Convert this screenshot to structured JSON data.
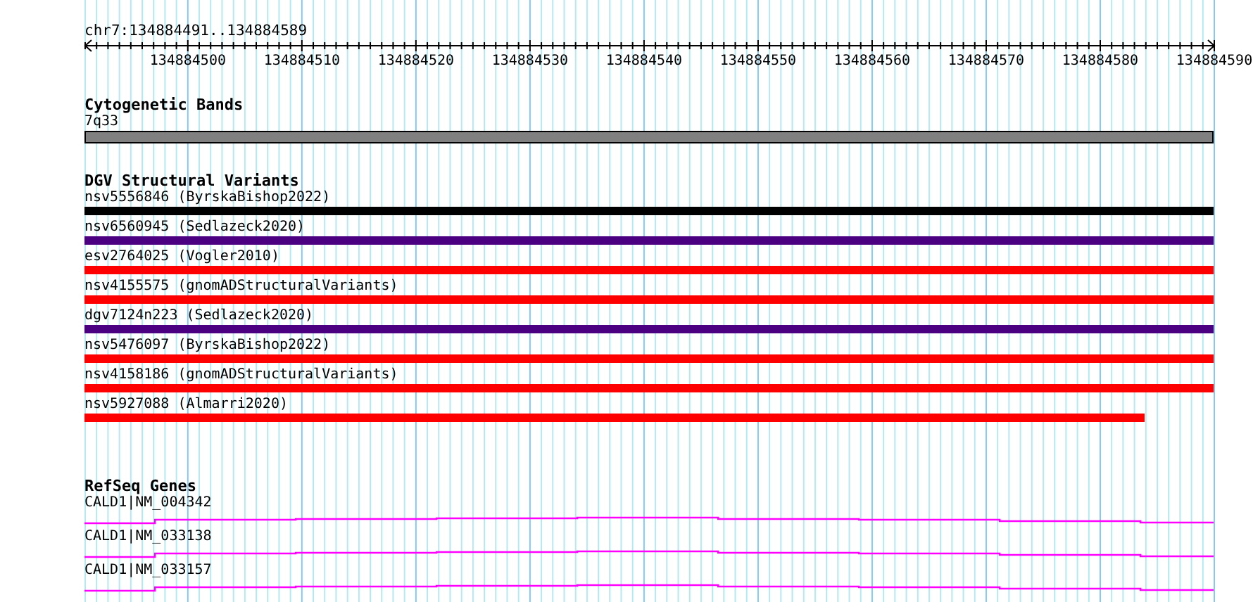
{
  "location": "chr7:134884491..134884589",
  "ruler": {
    "labels": [
      "134884500",
      "134884510",
      "134884520",
      "134884530",
      "134884540",
      "134884550",
      "134884560",
      "134884570",
      "134884580",
      "134884590"
    ]
  },
  "cytogenetic_bands": {
    "title": "Cytogenetic Bands",
    "band": {
      "label": "7q33"
    }
  },
  "dgv_structural_variants": {
    "title": "DGV Structural Variants",
    "variants": [
      {
        "label": "nsv5556846 (ByrskaBishop2022)",
        "color": "#000000",
        "extends_past_view": true
      },
      {
        "label": "nsv6560945 (Sedlazeck2020)",
        "color": "#4b0082",
        "extends_past_view": true
      },
      {
        "label": "esv2764025 (Vogler2010)",
        "color": "#ff0000",
        "extends_past_view": true
      },
      {
        "label": "nsv4155575 (gnomADStructuralVariants)",
        "color": "#ff0000",
        "extends_past_view": true
      },
      {
        "label": "dgv7124n223 (Sedlazeck2020)",
        "color": "#4b0082",
        "extends_past_view": true
      },
      {
        "label": "nsv5476097 (ByrskaBishop2022)",
        "color": "#ff0000",
        "extends_past_view": true
      },
      {
        "label": "nsv4158186 (gnomADStructuralVariants)",
        "color": "#ff0000",
        "extends_past_view": true
      },
      {
        "label": "nsv5927088 (Almarri2020)",
        "color": "#ff0000",
        "extends_past_view": false
      }
    ]
  },
  "refseq_genes": {
    "title": "RefSeq Genes",
    "genes": [
      {
        "label": "CALD1|NM_004342"
      },
      {
        "label": "CALD1|NM_033138"
      },
      {
        "label": "CALD1|NM_033157"
      }
    ]
  }
}
